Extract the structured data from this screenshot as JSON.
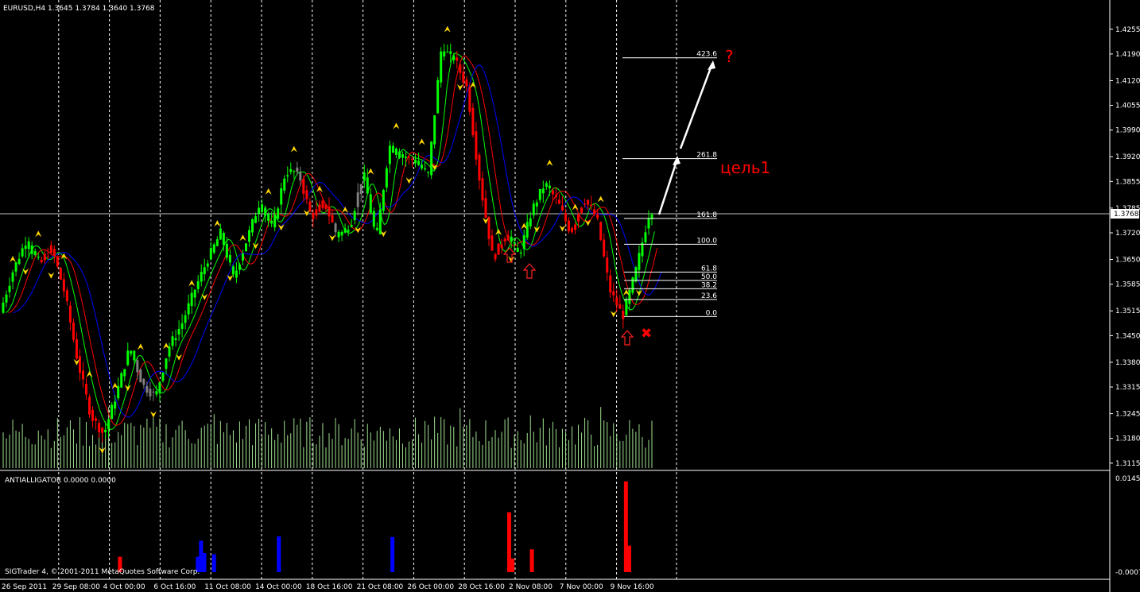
{
  "window_title": "EURUSD,H4  1.3645 1.3784 1.3640 1.3768",
  "indicator_title": "ANTIALLIGATOR 0.0000 0.0000",
  "copyright": "SIGTrader 4, © 2001-2011 MetaQuotes Software Corp.",
  "current_price_label": "1.3768",
  "annotations": {
    "target_label": "цель1",
    "question_mark": "?",
    "cross_mark": "✖"
  },
  "colors": {
    "bull": "#00ff00",
    "bear": "#ff0000",
    "neutral": "#808080",
    "ma_fast": "#00ff00",
    "ma_mid": "#ff0000",
    "ma_slow": "#0000ff",
    "volume": "#a0e090",
    "fractal": "#ffd700",
    "grid": "#ffffff",
    "anti_red": "#ff0000",
    "anti_blue": "#0000ff"
  },
  "chart_data": [
    {
      "type": "candlestick",
      "symbol": "EURUSD",
      "timeframe": "H4",
      "title": "EURUSD,H4",
      "ohlc_current": {
        "open": 1.3645,
        "high": 1.3784,
        "low": 1.364,
        "close": 1.3768
      },
      "y_ticks": [
        "1.4255",
        "1.4190",
        "1.4120",
        "1.4055",
        "1.3990",
        "1.3920",
        "1.3855",
        "1.3785",
        "1.3720",
        "1.3650",
        "1.3585",
        "1.3515",
        "1.3450",
        "1.3380",
        "1.3315",
        "1.3245",
        "1.3180",
        "1.3115"
      ],
      "ylim": [
        1.31,
        1.429
      ],
      "x_ticks": [
        "26 Sep 2011",
        "29 Sep 08:00",
        "4 Oct 00:00",
        "6 Oct 16:00",
        "11 Oct 08:00",
        "14 Oct 00:00",
        "18 Oct 16:00",
        "21 Oct 08:00",
        "26 Oct 00:00",
        "28 Oct 16:00",
        "2 Nov 08:00",
        "7 Nov 00:00",
        "9 Nov 16:00"
      ],
      "fibonacci": [
        {
          "level": "0.0",
          "price": 1.35
        },
        {
          "level": "23.6",
          "price": 1.3545
        },
        {
          "level": "38.2",
          "price": 1.3573
        },
        {
          "level": "50.0",
          "price": 1.3595
        },
        {
          "level": "61.8",
          "price": 1.3617
        },
        {
          "level": "100.0",
          "price": 1.369
        },
        {
          "level": "161.8",
          "price": 1.3758
        },
        {
          "level": "261.8",
          "price": 1.3915
        },
        {
          "level": "423.6",
          "price": 1.418
        }
      ],
      "price_path": [
        [
          0,
          1.351
        ],
        [
          0.02,
          1.362
        ],
        [
          0.04,
          1.37
        ],
        [
          0.06,
          1.364
        ],
        [
          0.08,
          1.368
        ],
        [
          0.1,
          1.356
        ],
        [
          0.12,
          1.338
        ],
        [
          0.14,
          1.324
        ],
        [
          0.16,
          1.319
        ],
        [
          0.18,
          1.33
        ],
        [
          0.2,
          1.342
        ],
        [
          0.22,
          1.332
        ],
        [
          0.24,
          1.329
        ],
        [
          0.26,
          1.342
        ],
        [
          0.28,
          1.348
        ],
        [
          0.3,
          1.357
        ],
        [
          0.32,
          1.365
        ],
        [
          0.34,
          1.372
        ],
        [
          0.36,
          1.36
        ],
        [
          0.38,
          1.37
        ],
        [
          0.4,
          1.38
        ],
        [
          0.42,
          1.373
        ],
        [
          0.44,
          1.388
        ],
        [
          0.46,
          1.388
        ],
        [
          0.48,
          1.376
        ],
        [
          0.5,
          1.38
        ],
        [
          0.52,
          1.371
        ],
        [
          0.54,
          1.374
        ],
        [
          0.56,
          1.388
        ],
        [
          0.58,
          1.37
        ],
        [
          0.6,
          1.395
        ],
        [
          0.62,
          1.392
        ],
        [
          0.64,
          1.391
        ],
        [
          0.66,
          1.387
        ],
        [
          0.68,
          1.42
        ],
        [
          0.7,
          1.418
        ],
        [
          0.72,
          1.41
        ],
        [
          0.74,
          1.385
        ],
        [
          0.76,
          1.365
        ],
        [
          0.78,
          1.372
        ],
        [
          0.8,
          1.366
        ],
        [
          0.82,
          1.378
        ],
        [
          0.84,
          1.385
        ],
        [
          0.86,
          1.38
        ],
        [
          0.88,
          1.372
        ],
        [
          0.9,
          1.381
        ],
        [
          0.92,
          1.376
        ],
        [
          0.94,
          1.357
        ],
        [
          0.96,
          1.35
        ],
        [
          0.98,
          1.362
        ],
        [
          1.0,
          1.3768
        ]
      ]
    },
    {
      "type": "bar",
      "title": "ANTIALLIGATOR 0.0000 0.0000",
      "y_ticks": [
        "0.0145",
        "-0.0007"
      ],
      "ylim": [
        -0.0007,
        0.0145
      ],
      "series": [
        {
          "color": "blue",
          "values": [
            [
              0.305,
              0.0044
            ],
            [
              0.31,
              0.0024
            ],
            [
              0.325,
              0.0022
            ],
            [
              0.3,
              0.0018
            ],
            [
              0.425,
              0.0051
            ],
            [
              0.6,
              0.005
            ]
          ]
        },
        {
          "color": "red",
          "values": [
            [
              0.18,
              0.0018
            ],
            [
              0.78,
              0.009
            ],
            [
              0.785,
              0.0015
            ],
            [
              0.815,
              0.003
            ],
            [
              0.96,
              0.014
            ],
            [
              0.965,
              0.0036
            ]
          ]
        }
      ]
    }
  ]
}
